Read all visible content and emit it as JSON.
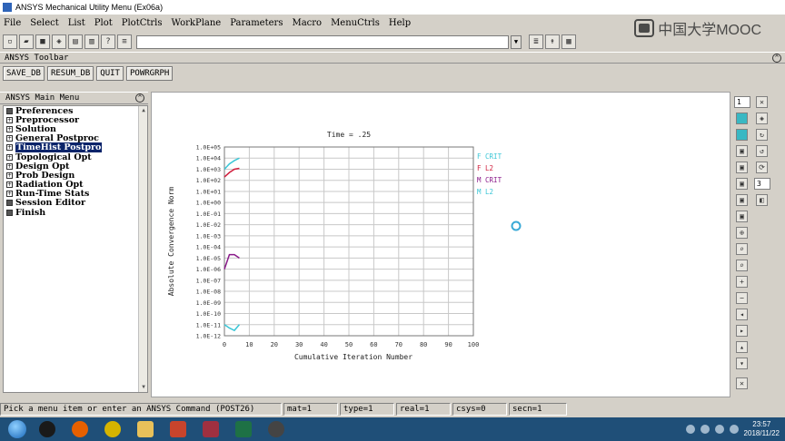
{
  "window": {
    "title": "ANSYS Mechanical Utility Menu (Ex06a)"
  },
  "watermark": {
    "text": "中国大学MOOC"
  },
  "menubar": [
    "File",
    "Select",
    "List",
    "Plot",
    "PlotCtrls",
    "WorkPlane",
    "Parameters",
    "Macro",
    "MenuCtrls",
    "Help"
  ],
  "ansys_toolbar": {
    "label": "ANSYS Toolbar",
    "buttons": [
      "SAVE_DB",
      "RESUM_DB",
      "QUIT",
      "POWRGRPH"
    ]
  },
  "main_menu": {
    "label": "ANSYS Main Menu",
    "items": [
      {
        "label": "Preferences",
        "type": "leaf"
      },
      {
        "label": "Preprocessor",
        "type": "expand"
      },
      {
        "label": "Solution",
        "type": "expand"
      },
      {
        "label": "General Postproc",
        "type": "expand"
      },
      {
        "label": "TimeHist Postpro",
        "type": "expand",
        "selected": true
      },
      {
        "label": "Topological Opt",
        "type": "expand"
      },
      {
        "label": "Design Opt",
        "type": "expand"
      },
      {
        "label": "Prob Design",
        "type": "expand"
      },
      {
        "label": "Radiation Opt",
        "type": "expand"
      },
      {
        "label": "Run-Time Stats",
        "type": "expand"
      },
      {
        "label": "Session Editor",
        "type": "leaf"
      },
      {
        "label": "Finish",
        "type": "leaf"
      }
    ]
  },
  "right_tools": {
    "window_select_1": "1",
    "window_select_2": "3"
  },
  "chart_data": {
    "type": "line",
    "title": "Time = .25",
    "xlabel": "Cumulative Iteration Number",
    "ylabel": "Absolute Convergence Norm",
    "xlim": [
      0,
      100
    ],
    "ylim_log10": [
      -12,
      5
    ],
    "log_scale_y": true,
    "grid": true,
    "legend_position": "right",
    "x_ticks": [
      "0",
      "10",
      "20",
      "30",
      "40",
      "50",
      "60",
      "70",
      "80",
      "90",
      "100"
    ],
    "y_ticks": [
      "1.0E+05",
      "1.0E+04",
      "1.0E+03",
      "1.0E+02",
      "1.0E+01",
      "1.0E+00",
      "1.0E-01",
      "1.0E-02",
      "1.0E-03",
      "1.0E-04",
      "1.0E-05",
      "1.0E-06",
      "1.0E-07",
      "1.0E-08",
      "1.0E-09",
      "1.0E-10",
      "1.0E-11",
      "1.0E-12"
    ],
    "series": [
      {
        "name": "F  CRIT",
        "color": "#39c6d6",
        "x": [
          0,
          2,
          4,
          6
        ],
        "y": [
          1000,
          3000,
          6000,
          10000
        ]
      },
      {
        "name": "F  L2",
        "color": "#d01e3c",
        "x": [
          0,
          2,
          4,
          6
        ],
        "y": [
          200,
          500,
          1000,
          1200
        ]
      },
      {
        "name": "M  CRIT",
        "color": "#8a1a8a",
        "x": [
          0,
          2,
          4,
          6
        ],
        "y": [
          1e-06,
          2e-05,
          2e-05,
          1e-05
        ]
      },
      {
        "name": "M  L2",
        "color": "#39c6d6",
        "x": [
          0,
          2,
          4,
          6
        ],
        "y": [
          1e-11,
          5e-12,
          3e-12,
          1e-11
        ]
      }
    ]
  },
  "status": {
    "prompt": "Pick a menu item or enter an ANSYS Command (POST26)",
    "mat": "mat=1",
    "type": "type=1",
    "real": "real=1",
    "csys": "csys=0",
    "secn": "secn=1"
  },
  "taskbar": {
    "time": "23:57",
    "date": "2018/11/22"
  }
}
